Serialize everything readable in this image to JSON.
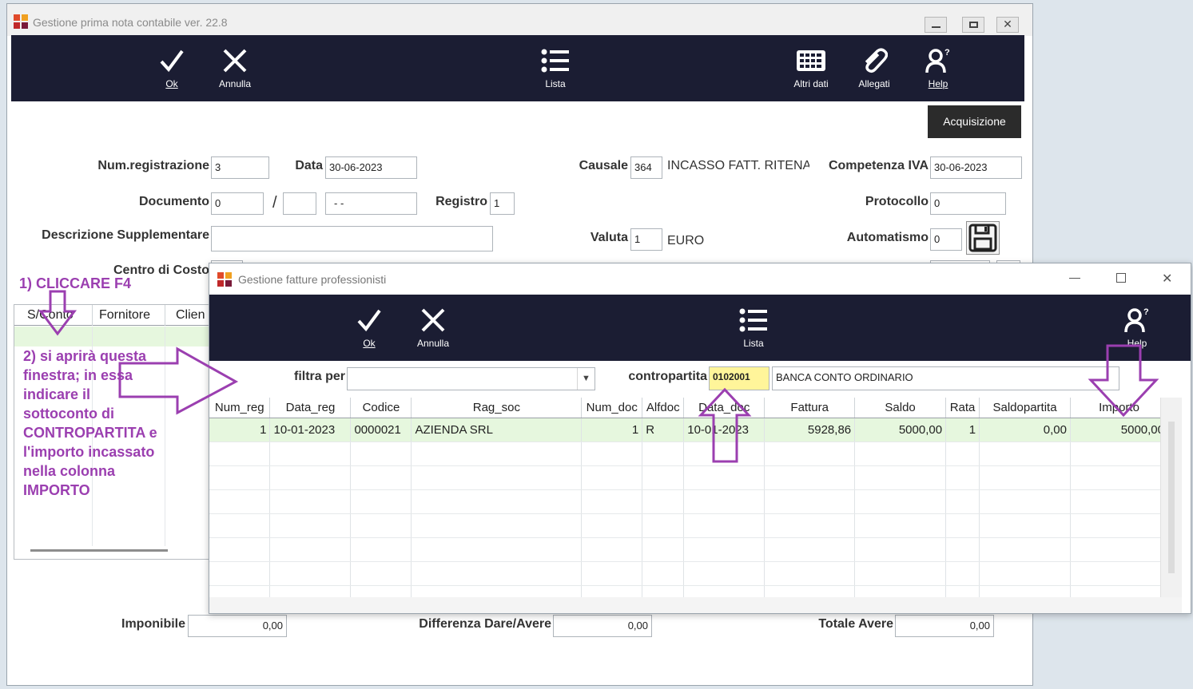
{
  "main_window": {
    "title": "Gestione prima nota contabile ver. 22.8",
    "toolbar": {
      "ok": "Ok",
      "annulla": "Annulla",
      "lista": "Lista",
      "altri_dati": "Altri dati",
      "allegati": "Allegati",
      "help": "Help"
    },
    "acquisizione": "Acquisizione",
    "fields": {
      "num_registrazione_label": "Num.registrazione",
      "num_registrazione": "3",
      "data_label": "Data",
      "data": "30-06-2023",
      "causale_label": "Causale",
      "causale": "364",
      "causale_desc": "INCASSO FATT. RITENA",
      "competenza_iva_label": "Competenza IVA",
      "competenza_iva": "30-06-2023",
      "documento_label": "Documento",
      "documento": "0",
      "slash": "/",
      "documento_bis": "",
      "documento_data": "- -",
      "registro_label": "Registro",
      "registro": "1",
      "protocollo_label": "Protocollo",
      "protocollo": "0",
      "descrizione_label": "Descrizione Supplementare",
      "descrizione": "",
      "valuta_label": "Valuta",
      "valuta": "1",
      "valuta_desc": "EURO",
      "automatismo_label": "Automatismo",
      "automatismo": "0",
      "centro_costo_label": "Centro di Costo"
    },
    "grid_headers": [
      "S/Conto",
      "Fornitore",
      "Clien"
    ],
    "totals": {
      "imponibile_label": "Imponibile",
      "imponibile": "0,00",
      "differenza_label": "Differenza Dare/Avere",
      "differenza": "0,00",
      "totale_avere_label": "Totale Avere",
      "totale_avere": "0,00"
    }
  },
  "popup": {
    "title": "Gestione fatture professionisti",
    "toolbar": {
      "ok": "Ok",
      "annulla": "Annulla",
      "lista": "Lista",
      "help": "Help"
    },
    "filtra_label": "filtra per",
    "filtra_value": "",
    "contropartita_label": "contropartita",
    "contropartita_code": "0102001",
    "contropartita_desc": "BANCA CONTO ORDINARIO",
    "columns": [
      "Num_reg",
      "Data_reg",
      "Codice",
      "Rag_soc",
      "Num_doc",
      "Alfdoc",
      "Data_doc",
      "Fattura",
      "Saldo",
      "Rata",
      "Saldopartita",
      "Importo"
    ],
    "rows": [
      [
        "1",
        "10-01-2023",
        "0000021",
        "AZIENDA SRL",
        "1",
        "R",
        "10-01-2023",
        "5928,86",
        "5000,00",
        "1",
        "0,00",
        "5000,00"
      ]
    ]
  },
  "annotations": {
    "step1": "1) CLICCARE F4",
    "step2": "2) si aprirà questa finestra; in essa indicare il sottoconto di CONTROPARTITA e l'importo incassato nella colonna IMPORTO"
  },
  "colors": {
    "annotation": "#9b3fb0",
    "toolbar": "#1b1d33",
    "highlight_row": "#e6f7de",
    "contropartita_bg": "#fff59a"
  }
}
